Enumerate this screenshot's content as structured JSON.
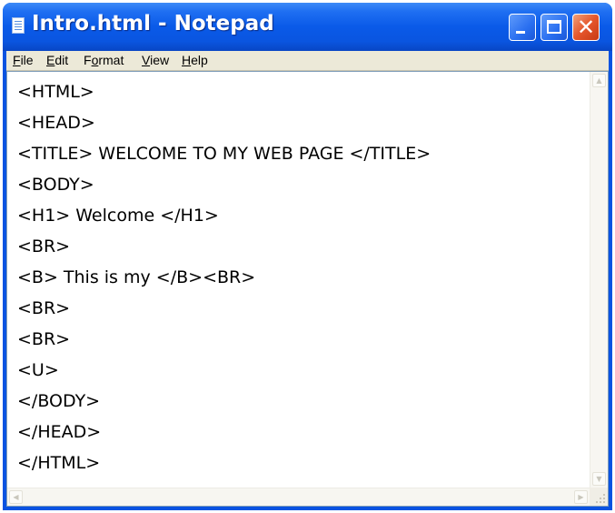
{
  "window": {
    "title": "Intro.html - Notepad",
    "app_icon": "notepad-icon",
    "controls": {
      "minimize": "minimize-icon",
      "maximize": "maximize-icon",
      "close": "close-icon",
      "close_glyph": "✕"
    }
  },
  "menu": {
    "items": [
      {
        "accel": "F",
        "rest": "ile"
      },
      {
        "accel": "E",
        "rest": "dit"
      },
      {
        "pre": "F",
        "accel": "o",
        "rest": "rmat"
      },
      {
        "accel": "V",
        "rest": "iew"
      },
      {
        "accel": "H",
        "rest": "elp"
      }
    ]
  },
  "editor": {
    "lines": [
      "<HTML>",
      "<HEAD>",
      "<TITLE> WELCOME TO MY WEB PAGE </TITLE>",
      "<BODY>",
      "<H1> Welcome </H1>",
      "<BR>",
      "<B> This is my </B><BR>",
      "<BR>",
      "<BR>",
      "<U>",
      "</BODY>",
      "</HEAD>",
      "</HTML>"
    ]
  },
  "scrollbars": {
    "up_arrow": "▲",
    "down_arrow": "▼",
    "left_arrow": "◀",
    "right_arrow": "▶"
  }
}
